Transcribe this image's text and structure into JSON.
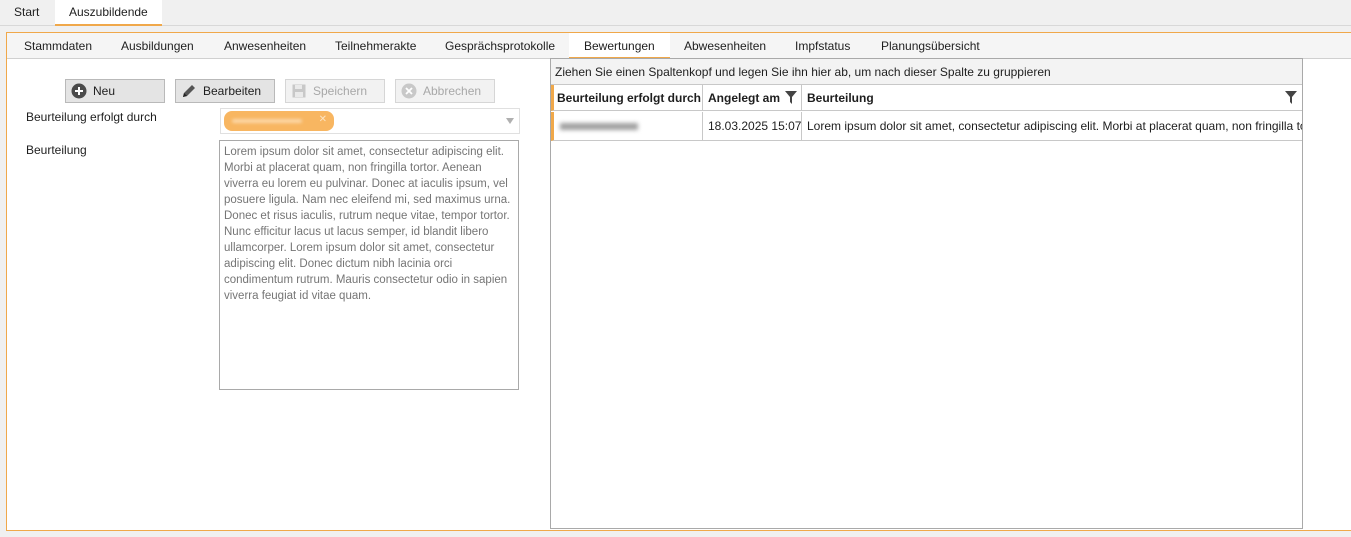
{
  "top_tabs": [
    {
      "label": "Start",
      "active": false
    },
    {
      "label": "Auszubildende",
      "active": true
    }
  ],
  "sub_tabs": [
    {
      "label": "Stammdaten",
      "active": false
    },
    {
      "label": "Ausbildungen",
      "active": false
    },
    {
      "label": "Anwesenheiten",
      "active": false
    },
    {
      "label": "Teilnehmerakte",
      "active": false
    },
    {
      "label": "Gesprächsprotokolle",
      "active": false
    },
    {
      "label": "Bewertungen",
      "active": true
    },
    {
      "label": "Abwesenheiten",
      "active": false
    },
    {
      "label": "Impfstatus",
      "active": false
    },
    {
      "label": "Planungsübersicht",
      "active": false
    }
  ],
  "toolbar": {
    "new_label": "Neu",
    "edit_label": "Bearbeiten",
    "save_label": "Speichern",
    "cancel_label": "Abbrechen"
  },
  "form": {
    "evaluator_label": "Beurteilung erfolgt durch",
    "evaluation_label": "Beurteilung",
    "evaluation_text": "Lorem ipsum dolor sit amet, consectetur adipiscing elit. Morbi at placerat quam, non fringilla tortor. Aenean viverra eu lorem eu pulvinar. Donec at iaculis ipsum, vel posuere ligula. Nam nec eleifend mi, sed maximus urna. Donec et risus iaculis, rutrum neque vitae, tempor tortor. Nunc efficitur lacus ut lacus semper, id blandit libero ullamcorper. Lorem ipsum dolor sit amet, consectetur adipiscing elit. Donec dictum nibh lacinia orci condimentum rutrum. Mauris consectetur odio in sapien viverra feugiat id vitae quam."
  },
  "grid": {
    "group_hint": "Ziehen Sie einen Spaltenkopf und legen Sie ihn hier ab, um nach dieser Spalte zu gruppieren",
    "columns": [
      "Beurteilung erfolgt durch",
      "Angelegt am",
      "Beurteilung"
    ],
    "rows": [
      {
        "evaluator": "",
        "created": "18.03.2025 15:07",
        "text": "Lorem ipsum dolor sit amet, consectetur adipiscing elit. Morbi at placerat quam, non fringilla tortor."
      }
    ]
  },
  "colors": {
    "accent": "#f0a84a",
    "chip": "#f8b661"
  },
  "icons": {
    "new": "plus-circle-icon",
    "edit": "pencil-icon",
    "save": "floppy-disk-icon",
    "cancel": "x-circle-icon",
    "filter": "funnel-icon",
    "dropdown": "chevron-down-icon"
  }
}
